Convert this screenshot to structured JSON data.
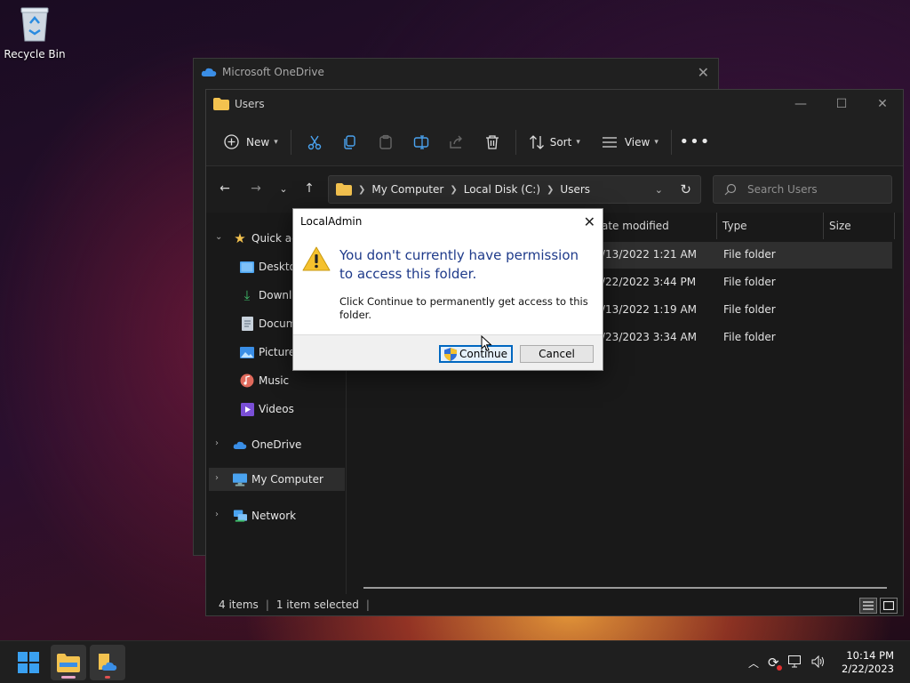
{
  "desktop": {
    "recycle_bin_label": "Recycle Bin"
  },
  "onedrive_window": {
    "title": "Microsoft OneDrive"
  },
  "explorer": {
    "title": "Users",
    "toolbar": {
      "new_label": "New",
      "sort_label": "Sort",
      "view_label": "View"
    },
    "breadcrumb": [
      "My Computer",
      "Local Disk (C:)",
      "Users"
    ],
    "search_placeholder": "Search Users",
    "sidebar": {
      "quick_access": "Quick ac",
      "desktop": "Desktop",
      "downloads": "Downlo",
      "documents": "Docum",
      "pictures": "Pictures",
      "music": "Music",
      "videos": "Videos",
      "onedrive": "OneDrive",
      "my_computer": "My Computer",
      "network": "Network"
    },
    "columns": {
      "date": "ate modified",
      "type": "Type",
      "size": "Size"
    },
    "rows": [
      {
        "date": "/13/2022 1:21 AM",
        "type": "File folder"
      },
      {
        "date": "/22/2022 3:44 PM",
        "type": "File folder"
      },
      {
        "date": "/13/2022 1:19 AM",
        "type": "File folder"
      },
      {
        "date": "/23/2023 3:34 AM",
        "type": "File folder"
      }
    ],
    "status": {
      "items": "4 items",
      "selected": "1 item selected"
    }
  },
  "dialog": {
    "title": "LocalAdmin",
    "main_instruction": "You don't currently have permission to access this folder.",
    "content": "Click Continue to permanently get access to this folder.",
    "continue_label": "Continue",
    "cancel_label": "Cancel"
  },
  "taskbar": {
    "time": "10:14 PM",
    "date": "2/22/2023"
  },
  "colors": {
    "accent": "#0067c0",
    "dialog_text": "#1e3a8a",
    "folder": "#f3c24f"
  }
}
